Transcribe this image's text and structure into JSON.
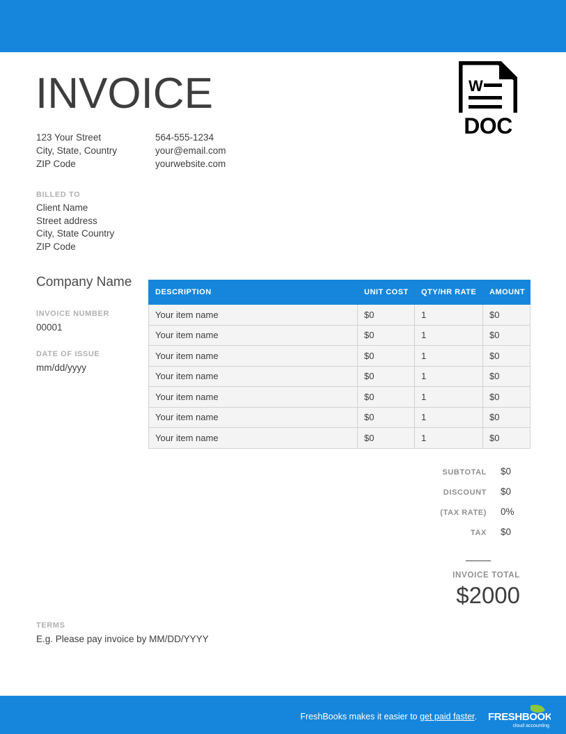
{
  "theme": {
    "accent": "#1586dc",
    "text": "#3d3d3d",
    "muted_label": "#b0b0b0",
    "totals_label": "#8f8f8f",
    "row_bg": "#f4f4f4",
    "row_border": "#d2d2d2"
  },
  "header": {
    "title": "INVOICE",
    "address_left": [
      "123 Your Street",
      "City, State, Country",
      "ZIP Code"
    ],
    "address_right": [
      "564-555-1234",
      "your@email.com",
      "yourwebsite.com"
    ],
    "doc_icon": {
      "name": "doc-file-icon",
      "word_mark": "W",
      "label": "DOC"
    }
  },
  "billed_to": {
    "label": "BILLED TO",
    "lines": [
      "Client Name",
      "Street address",
      "City, State Country",
      "ZIP Code"
    ]
  },
  "meta": {
    "company_name": "Company Name",
    "invoice_number_label": "INVOICE NUMBER",
    "invoice_number": "00001",
    "date_of_issue_label": "DATE OF ISSUE",
    "date_of_issue": "mm/dd/yyyy"
  },
  "items_table": {
    "columns": [
      "DESCRIPTION",
      "UNIT COST",
      "QTY/HR RATE",
      "AMOUNT"
    ],
    "rows": [
      [
        "Your item name",
        "$0",
        "1",
        "$0"
      ],
      [
        "Your item name",
        "$0",
        "1",
        "$0"
      ],
      [
        "Your item name",
        "$0",
        "1",
        "$0"
      ],
      [
        "Your item name",
        "$0",
        "1",
        "$0"
      ],
      [
        "Your item name",
        "$0",
        "1",
        "$0"
      ],
      [
        "Your item name",
        "$0",
        "1",
        "$0"
      ],
      [
        "Your item name",
        "$0",
        "1",
        "$0"
      ]
    ]
  },
  "totals": {
    "rows": [
      {
        "label": "SUBTOTAL",
        "value": "$0"
      },
      {
        "label": "DISCOUNT",
        "value": "$0"
      },
      {
        "label": "(TAX RATE)",
        "value": "0%"
      },
      {
        "label": "TAX",
        "value": "$0"
      }
    ],
    "grand_label": "INVOICE TOTAL",
    "grand_value": "$2000"
  },
  "terms": {
    "label": "TERMS",
    "value": "E.g. Please pay invoice by MM/DD/YYYY"
  },
  "footer": {
    "text_before": "FreshBooks makes it easier to",
    "link_text": "get paid faster",
    "text_after": ".",
    "logo": {
      "name": "freshbooks-logo",
      "wordmark": "FRESHBOOKS",
      "tagline": "cloud accounting",
      "leaf_color": "#8cc63e"
    }
  }
}
